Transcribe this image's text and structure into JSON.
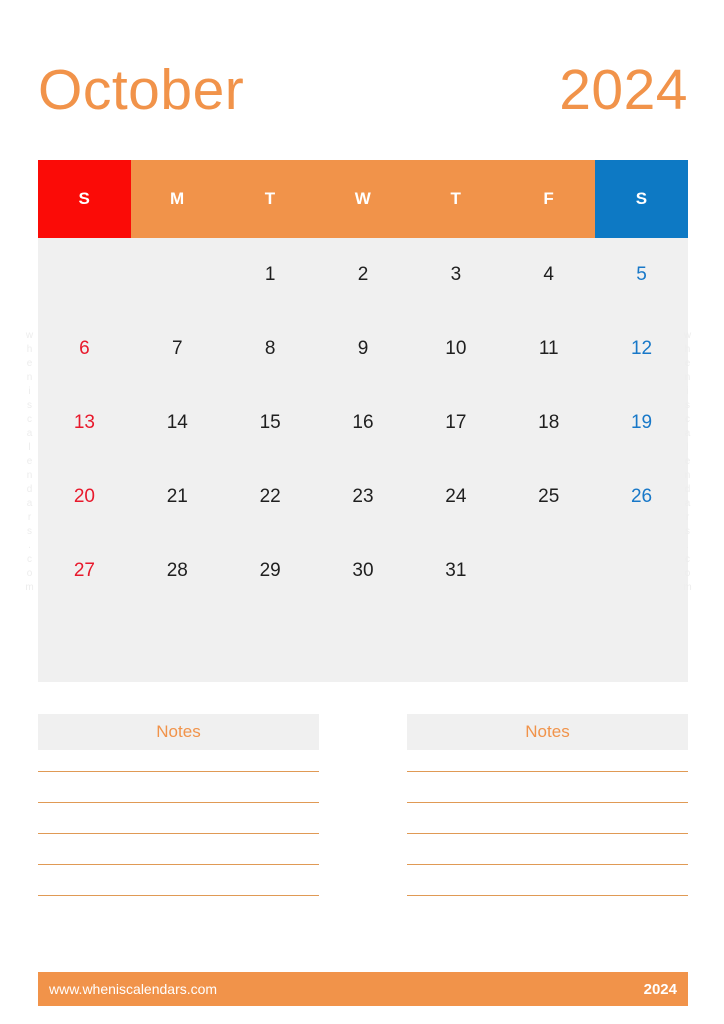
{
  "header": {
    "month": "October",
    "year": "2024"
  },
  "calendar": {
    "weekday_headers": [
      {
        "label": "S",
        "kind": "sun"
      },
      {
        "label": "M",
        "kind": "weekday"
      },
      {
        "label": "T",
        "kind": "weekday"
      },
      {
        "label": "W",
        "kind": "weekday"
      },
      {
        "label": "T",
        "kind": "weekday"
      },
      {
        "label": "F",
        "kind": "weekday"
      },
      {
        "label": "S",
        "kind": "sat"
      }
    ],
    "weeks": [
      [
        "",
        "",
        "1",
        "2",
        "3",
        "4",
        "5"
      ],
      [
        "6",
        "7",
        "8",
        "9",
        "10",
        "11",
        "12"
      ],
      [
        "13",
        "14",
        "15",
        "16",
        "17",
        "18",
        "19"
      ],
      [
        "20",
        "21",
        "22",
        "23",
        "24",
        "25",
        "26"
      ],
      [
        "27",
        "28",
        "29",
        "30",
        "31",
        "",
        ""
      ],
      [
        "",
        "",
        "",
        "",
        "",
        "",
        ""
      ]
    ]
  },
  "notes": {
    "left_title": "Notes",
    "right_title": "Notes",
    "line_count": 5
  },
  "footer": {
    "url": "www.wheniscalendars.com",
    "year": "2024"
  },
  "watermark": {
    "text": "wheniscalendars.com"
  },
  "colors": {
    "orange": "#F1934A",
    "red": "#FB0B07",
    "blue": "#0D79C4",
    "day_red": "#E8192C",
    "day_blue": "#1878C8",
    "grid_bg": "#F0F0F0",
    "line": "#E09A55"
  }
}
